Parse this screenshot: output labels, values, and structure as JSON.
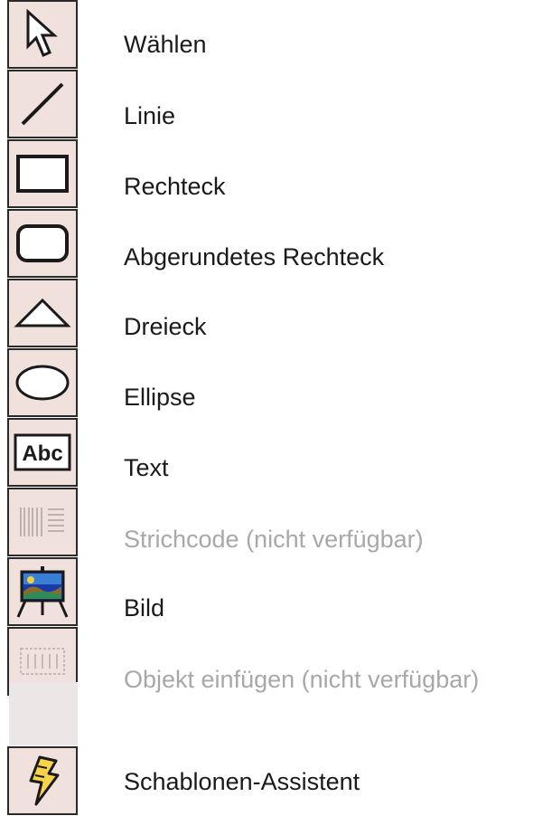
{
  "tools": [
    {
      "id": "select",
      "label": "Wählen",
      "icon": "arrow-pointer-icon",
      "enabled": true
    },
    {
      "id": "line",
      "label": "Linie",
      "icon": "line-icon",
      "enabled": true
    },
    {
      "id": "rectangle",
      "label": "Rechteck",
      "icon": "rectangle-icon",
      "enabled": true
    },
    {
      "id": "rounded-rectangle",
      "label": "Abgerundetes Rechteck",
      "icon": "rounded-rectangle-icon",
      "enabled": true
    },
    {
      "id": "triangle",
      "label": "Dreieck",
      "icon": "triangle-icon",
      "enabled": true
    },
    {
      "id": "ellipse",
      "label": "Ellipse",
      "icon": "ellipse-icon",
      "enabled": true
    },
    {
      "id": "text",
      "label": "Text",
      "icon": "text-abc-icon",
      "icon_text": "Abc",
      "enabled": true
    },
    {
      "id": "barcode",
      "label": "Strichcode (nicht verfügbar)",
      "icon": "barcode-icon",
      "enabled": false
    },
    {
      "id": "image",
      "label": "Bild",
      "icon": "picture-easel-icon",
      "enabled": true
    },
    {
      "id": "insert-object",
      "label": "Objekt einfügen (nicht verfügbar)",
      "icon": "insert-object-icon",
      "enabled": false
    },
    {
      "id": "template-wizard",
      "label": "Schablonen-Assistent",
      "icon": "lightning-wizard-icon",
      "enabled": true
    }
  ],
  "colors": {
    "button_face": "#f0e1dd",
    "border": "#2a2a2a",
    "label": "#1a1a1a",
    "label_disabled": "#a8a8a8"
  }
}
